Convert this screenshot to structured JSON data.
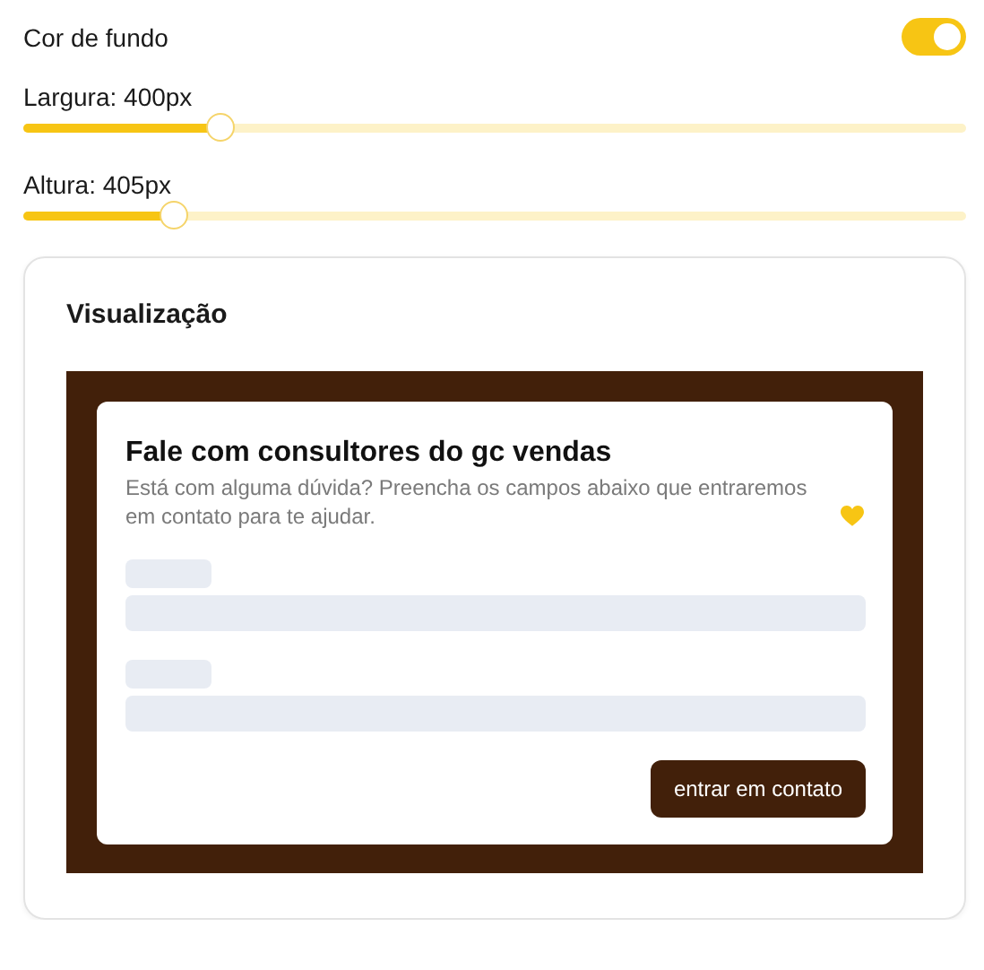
{
  "background_toggle": {
    "label": "Cor de fundo",
    "on": true
  },
  "sliders": [
    {
      "label": "Largura: 400px",
      "level": 0.21
    },
    {
      "label": "Altura: 405px",
      "level": 0.16
    }
  ],
  "preview": {
    "title": "Visualização",
    "form": {
      "title": "Fale com consultores do gc vendas",
      "description": "Está com alguma dúvida? Preencha os campos abaixo que entraremos em contato para te ajudar.",
      "fields": [
        {
          "kind": "skeleton"
        },
        {
          "kind": "skeleton"
        }
      ],
      "button": "entrar em contato"
    }
  }
}
